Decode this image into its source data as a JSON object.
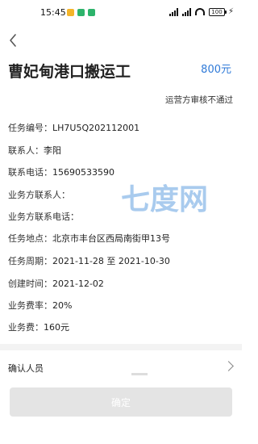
{
  "status_bar": {
    "time": "15:45",
    "battery": "100",
    "app_colors": [
      "#f4b52a",
      "#2db36b",
      "#2db36b"
    ]
  },
  "job": {
    "title": "曹妃甸港口搬运工",
    "price": "800元",
    "status": "运营方审核不通过"
  },
  "fields": [
    {
      "label": "任务编号：",
      "value": "LH7U5Q202112001"
    },
    {
      "label": "联系人：",
      "value": "李阳"
    },
    {
      "label": "联系电话：",
      "value": "15690533590"
    },
    {
      "label": "业务方联系人：",
      "value": ""
    },
    {
      "label": "业务方联系电话：",
      "value": ""
    },
    {
      "label": "任务地点：",
      "value": "北京市丰台区西局南街甲13号"
    },
    {
      "label": "任务周期：",
      "value": "2021-11-28 至 2021-10-30"
    },
    {
      "label": "创建时间：",
      "value": "2021-12-02"
    },
    {
      "label": "业务费率：",
      "value": "20%"
    },
    {
      "label": "业务费：",
      "value": "160元"
    }
  ],
  "watermark_text": "七度网",
  "confirm_personnel_label": "确认人员",
  "confirm_button_label": "确定",
  "colors": {
    "price": "#2f7ad8",
    "button_disabled": "#e4e4e4"
  }
}
